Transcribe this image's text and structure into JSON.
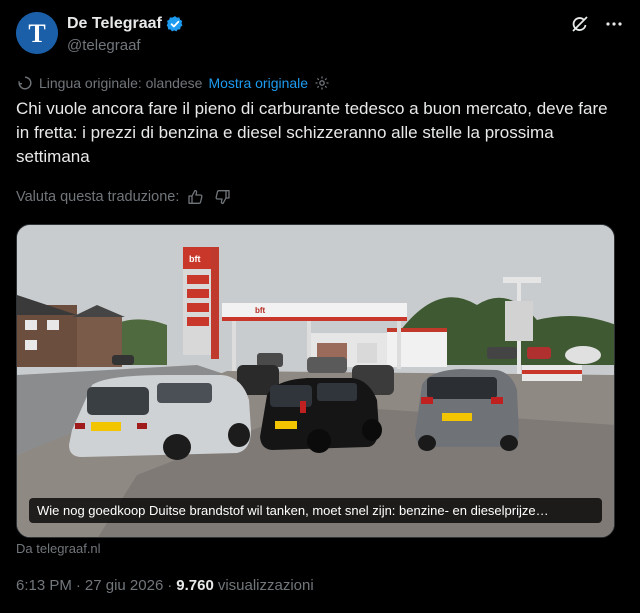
{
  "author": {
    "display_name": "De Telegraaf",
    "handle": "@telegraaf",
    "verified": true,
    "avatar_letter": "T"
  },
  "header_icons": [
    "grok-icon",
    "more-icon"
  ],
  "translation": {
    "original_language": "Lingua originale: olandese",
    "show_original": "Mostra originale"
  },
  "tweet_text": "Chi vuole ancora fare il pieno di carburante tedesco a buon mercato, deve fare in fretta: i prezzi di benzina e diesel schizzeranno alle stelle la prossima settimana",
  "rate_translation": "Valuta questa traduzione:",
  "media": {
    "caption": "Wie nog goedkoop Duitse brandstof wil tanken, moet snel zijn: benzine- en dieselprijze…",
    "sign_text": "bft",
    "canopy_text": "bft"
  },
  "source": "Da telegraaf.nl",
  "meta": {
    "time": "6:13 PM",
    "sep1": "·",
    "date": "27 giu 2026",
    "sep2": "·",
    "views_count": "9.760",
    "views_label": "visualizzazioni"
  },
  "colors": {
    "link": "#1d9bf0",
    "muted": "#71767b",
    "verified": "#1d9bf0"
  }
}
